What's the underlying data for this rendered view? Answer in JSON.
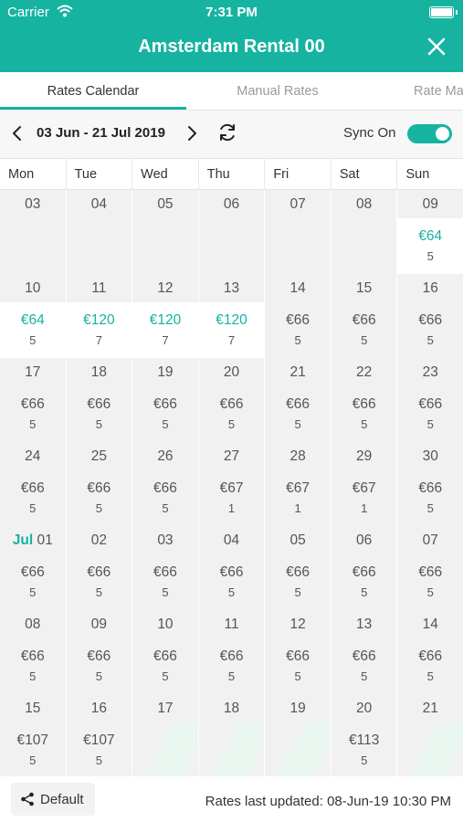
{
  "status_bar": {
    "carrier": "Carrier",
    "time": "7:31 PM"
  },
  "header": {
    "title": "Amsterdam Rental 00",
    "close_icon": "close-icon"
  },
  "tabs": [
    {
      "label": "Rates Calendar",
      "active": true
    },
    {
      "label": "Manual Rates",
      "active": false
    },
    {
      "label": "Rate Ma",
      "active": false
    }
  ],
  "datebar": {
    "range": "03 Jun - 21 Jul 2019",
    "sync_label": "Sync On",
    "sync_on": true
  },
  "weekdays": [
    "Mon",
    "Tue",
    "Wed",
    "Thu",
    "Fri",
    "Sat",
    "Sun"
  ],
  "weeks": [
    {
      "dates": [
        "03",
        "04",
        "05",
        "06",
        "07",
        "08",
        "09"
      ],
      "rates": [
        null,
        null,
        null,
        null,
        null,
        null,
        {
          "price": "€64",
          "nights": "5",
          "teal": true
        }
      ]
    },
    {
      "dates": [
        "10",
        "11",
        "12",
        "13",
        "14",
        "15",
        "16"
      ],
      "rates": [
        {
          "price": "€64",
          "nights": "5",
          "teal": true
        },
        {
          "price": "€120",
          "nights": "7",
          "teal": true
        },
        {
          "price": "€120",
          "nights": "7",
          "teal": true
        },
        {
          "price": "€120",
          "nights": "7",
          "teal": true
        },
        {
          "price": "€66",
          "nights": "5"
        },
        {
          "price": "€66",
          "nights": "5"
        },
        {
          "price": "€66",
          "nights": "5"
        }
      ]
    },
    {
      "dates": [
        "17",
        "18",
        "19",
        "20",
        "21",
        "22",
        "23"
      ],
      "rates": [
        {
          "price": "€66",
          "nights": "5"
        },
        {
          "price": "€66",
          "nights": "5"
        },
        {
          "price": "€66",
          "nights": "5"
        },
        {
          "price": "€66",
          "nights": "5"
        },
        {
          "price": "€66",
          "nights": "5"
        },
        {
          "price": "€66",
          "nights": "5"
        },
        {
          "price": "€66",
          "nights": "5"
        }
      ]
    },
    {
      "dates": [
        "24",
        "25",
        "26",
        "27",
        "28",
        "29",
        "30"
      ],
      "rates": [
        {
          "price": "€66",
          "nights": "5"
        },
        {
          "price": "€66",
          "nights": "5"
        },
        {
          "price": "€66",
          "nights": "5"
        },
        {
          "price": "€67",
          "nights": "1"
        },
        {
          "price": "€67",
          "nights": "1"
        },
        {
          "price": "€67",
          "nights": "1"
        },
        {
          "price": "€66",
          "nights": "5"
        }
      ]
    },
    {
      "month": "Jul",
      "dates": [
        "01",
        "02",
        "03",
        "04",
        "05",
        "06",
        "07"
      ],
      "rates": [
        {
          "price": "€66",
          "nights": "5"
        },
        {
          "price": "€66",
          "nights": "5"
        },
        {
          "price": "€66",
          "nights": "5"
        },
        {
          "price": "€66",
          "nights": "5"
        },
        {
          "price": "€66",
          "nights": "5"
        },
        {
          "price": "€66",
          "nights": "5"
        },
        {
          "price": "€66",
          "nights": "5"
        }
      ]
    },
    {
      "dates": [
        "08",
        "09",
        "10",
        "11",
        "12",
        "13",
        "14"
      ],
      "rates": [
        {
          "price": "€66",
          "nights": "5"
        },
        {
          "price": "€66",
          "nights": "5"
        },
        {
          "price": "€66",
          "nights": "5"
        },
        {
          "price": "€66",
          "nights": "5"
        },
        {
          "price": "€66",
          "nights": "5"
        },
        {
          "price": "€66",
          "nights": "5"
        },
        {
          "price": "€66",
          "nights": "5"
        }
      ]
    },
    {
      "dates": [
        "15",
        "16",
        "17",
        "18",
        "19",
        "20",
        "21"
      ],
      "rates": [
        {
          "price": "€107",
          "nights": "5"
        },
        {
          "price": "€107",
          "nights": "5"
        },
        "stripe",
        "stripe",
        "stripe",
        {
          "price": "€113",
          "nights": "5"
        },
        "stripe"
      ]
    }
  ],
  "footer": {
    "default_label": "Default",
    "updated": "Rates last updated: 08-Jun-19 10:30 PM"
  },
  "colors": {
    "accent": "#16b3a1",
    "cell_bg": "#f1f1f1",
    "stripe": "#eaf7f0"
  }
}
